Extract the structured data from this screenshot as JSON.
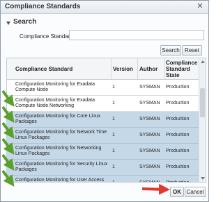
{
  "dialog": {
    "title": "Compliance Standards",
    "close_glyph": "✕"
  },
  "search": {
    "section_title": "Search",
    "field_label": "Compliance Standard",
    "field_value": "",
    "search_label": "Search",
    "reset_label": "Reset"
  },
  "table": {
    "columns": [
      "Compliance Standard",
      "Version",
      "Author",
      "Compliance Standard State"
    ],
    "rows": [
      {
        "standard": "Configuration Monitoring for Exadata Compute Node",
        "version": "1",
        "author": "SYSMAN",
        "state": "Production",
        "selected": false
      },
      {
        "standard": "Configuration Monitoring for Exadata Compute Node Networking",
        "version": "1",
        "author": "SYSMAN",
        "state": "Production",
        "selected": false
      },
      {
        "standard": "Configuration Monitoring for Core Linux Packages",
        "version": "1",
        "author": "SYSMAN",
        "state": "Production",
        "selected": true
      },
      {
        "standard": "Configuration Monitoring for Network Time Linux Packages",
        "version": "1",
        "author": "SYSMAN",
        "state": "Production",
        "selected": true
      },
      {
        "standard": "Configuration Monitoring for Networking Linux Packages",
        "version": "1",
        "author": "SYSMAN",
        "state": "Production",
        "selected": true
      },
      {
        "standard": "Configuration Monitoring for Security Linux Packages",
        "version": "1",
        "author": "SYSMAN",
        "state": "Production",
        "selected": true
      },
      {
        "standard": "Configuration Monitoring for User Access Linux Packages",
        "version": "1",
        "author": "SYSMAN",
        "state": "Production",
        "selected": true
      }
    ]
  },
  "footer": {
    "ok_label": "OK",
    "cancel_label": "Cancel"
  },
  "annotations": {
    "arrow_color_green": "#5aa02c",
    "arrow_color_red": "#e03a2e",
    "green_arrow_icon": "green-arrow-icon",
    "red_arrow_icon": "red-arrow-icon"
  }
}
